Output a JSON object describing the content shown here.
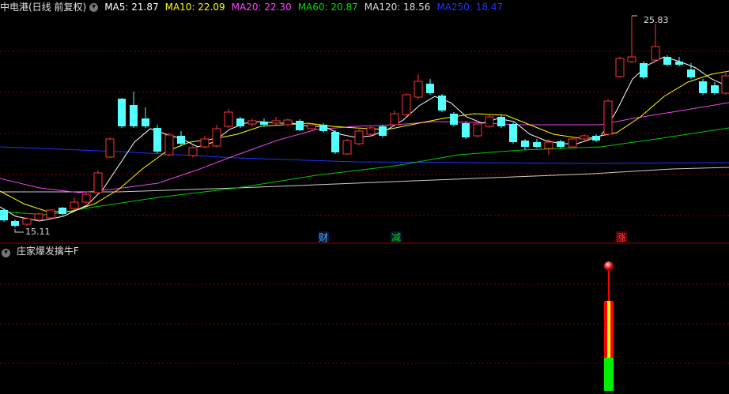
{
  "header": {
    "title": "中电港(日线 前复权)",
    "ma": [
      {
        "label": "MA5: 21.87",
        "color": "#ffffff"
      },
      {
        "label": "MA10: 22.09",
        "color": "#ffff00"
      },
      {
        "label": "MA20: 22.30",
        "color": "#ff44ff"
      },
      {
        "label": "MA60: 20.87",
        "color": "#00dd00"
      },
      {
        "label": "MA120: 18.56",
        "color": "#dddddd"
      },
      {
        "label": "MA250: 18.47",
        "color": "#2233ff"
      }
    ]
  },
  "price_panel": {
    "high_label": "25.83",
    "low_label": "15.11",
    "markers": [
      {
        "text": "财",
        "color": "#55aaff"
      },
      {
        "text": "减",
        "color": "#00dd00"
      },
      {
        "text": "涨",
        "color": "#ff4444"
      }
    ]
  },
  "indicator": {
    "title": "庄家爆发擒牛F"
  },
  "colors": {
    "up": "#ff3333",
    "down": "#54ffff",
    "grid": "#7a0000",
    "axis": "#a00000"
  }
}
